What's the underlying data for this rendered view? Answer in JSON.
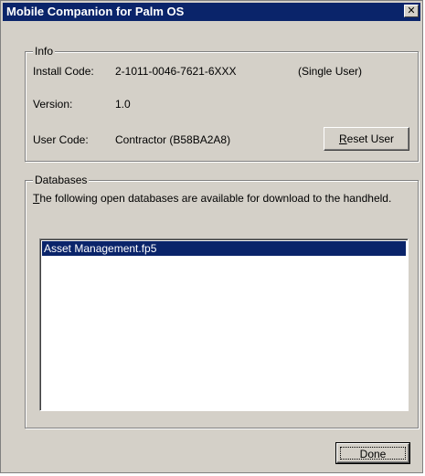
{
  "window": {
    "title": "Mobile Companion for Palm OS",
    "close_glyph": "✕"
  },
  "info": {
    "legend": "Info",
    "install_code_label": "Install Code:",
    "install_code_value": "2-1011-0046-7621-6XXX",
    "license_type": "(Single User)",
    "version_label": "Version:",
    "version_value": "1.0",
    "user_code_label": "User Code:",
    "user_code_value": "Contractor (B58BA2A8)",
    "reset_button": {
      "accel": "R",
      "rest": "eset User"
    }
  },
  "databases": {
    "legend": "Databases",
    "description": {
      "accel": "T",
      "rest": "he following open databases are available for download to the handheld."
    },
    "items": [
      {
        "label": "Asset Management.fp5",
        "selected": true
      }
    ]
  },
  "footer": {
    "done_label": "Done"
  },
  "colors": {
    "face": "#d4d0c8",
    "titlebar": "#0a246a",
    "selection": "#0a246a"
  }
}
